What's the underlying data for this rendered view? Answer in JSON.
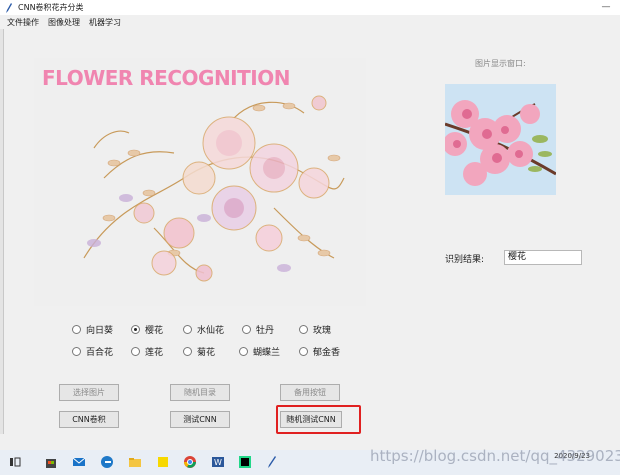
{
  "window": {
    "title": "CNN卷积花卉分类",
    "minimize": "—"
  },
  "menu": [
    "文件操作",
    "图像处理",
    "机器学习"
  ],
  "panel": {
    "heading": "FLOWER RECOGNITION"
  },
  "display": {
    "label": "图片显示窗口:"
  },
  "result": {
    "label": "识别结果:",
    "value": "樱花"
  },
  "radios": [
    {
      "label": "向日葵",
      "checked": false
    },
    {
      "label": "樱花",
      "checked": true
    },
    {
      "label": "水仙花",
      "checked": false
    },
    {
      "label": "牡丹",
      "checked": false
    },
    {
      "label": "玫瑰",
      "checked": false
    },
    {
      "label": "百合花",
      "checked": false
    },
    {
      "label": "莲花",
      "checked": false
    },
    {
      "label": "菊花",
      "checked": false
    },
    {
      "label": "蝴蝶兰",
      "checked": false
    },
    {
      "label": "郁金香",
      "checked": false
    }
  ],
  "buttons": {
    "select_image": "选择图片",
    "random_dir": "随机目录",
    "spare": "备用按钮",
    "cnn": "CNN卷积",
    "test_cnn": "测试CNN",
    "random_test_cnn": "随机测试CNN"
  },
  "taskbar": {
    "time": "",
    "date": "2020/9/23"
  },
  "watermark": "https://blog.csdn.net/qq_43290233",
  "colors": {
    "accent_pink": "#f085b0",
    "highlight_red": "#e02020"
  }
}
